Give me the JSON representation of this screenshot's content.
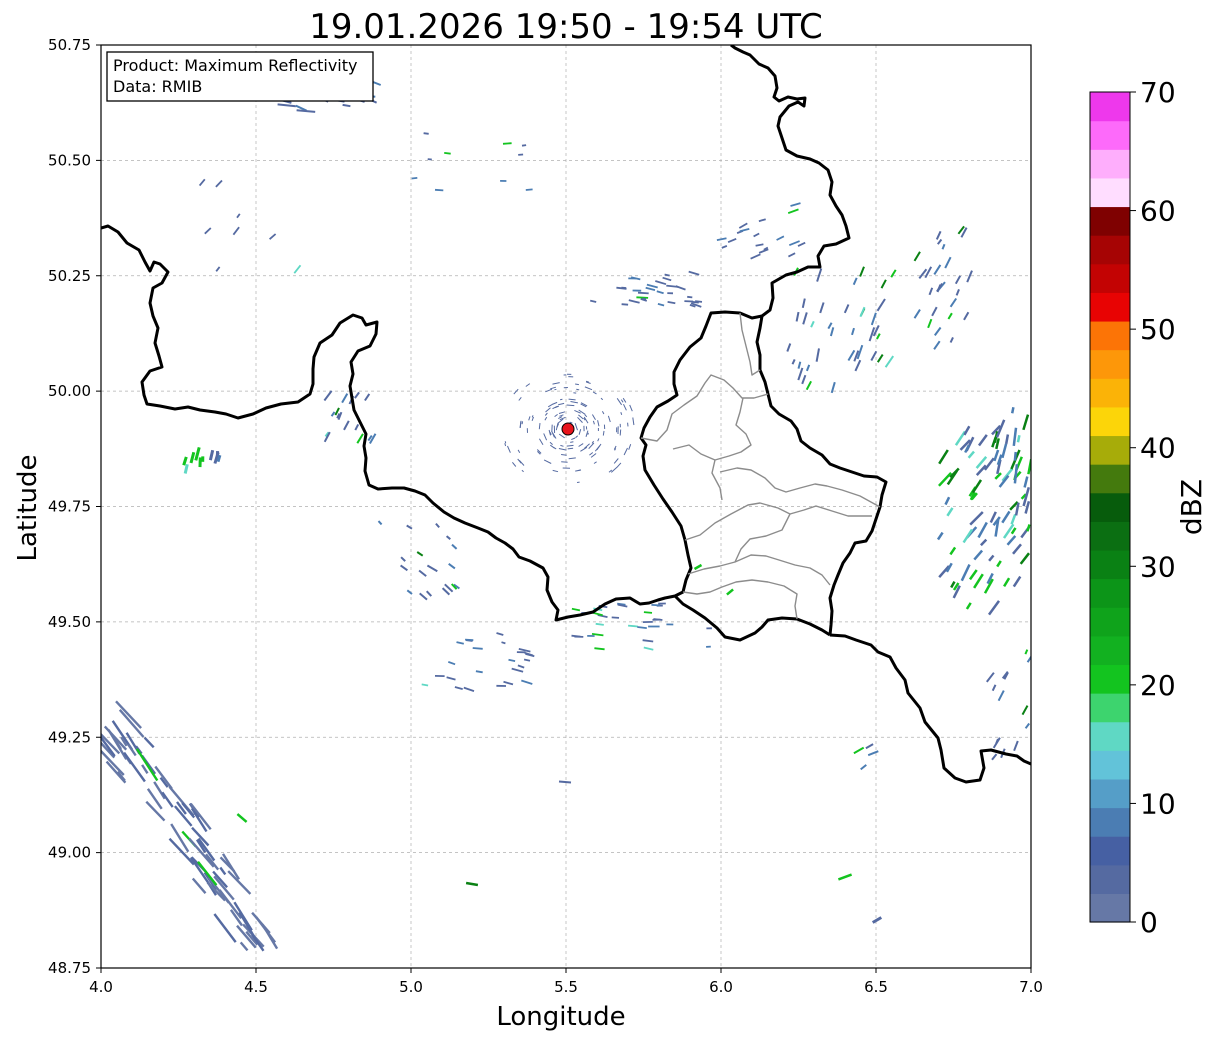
{
  "title": "19.01.2026 19:50 - 19:54 UTC",
  "info_box": {
    "line1": "Product: Maximum Reflectivity",
    "line2": "Data: RMIB"
  },
  "axes": {
    "xlabel": "Longitude",
    "ylabel": "Latitude",
    "xlim": [
      4.0,
      7.0
    ],
    "ylim": [
      48.75,
      50.75
    ],
    "xticks": [
      "4.0",
      "4.5",
      "5.0",
      "5.5",
      "6.0",
      "6.5",
      "7.0"
    ],
    "yticks": [
      "48.75",
      "49.00",
      "49.25",
      "49.50",
      "49.75",
      "50.00",
      "50.25",
      "50.50",
      "50.75"
    ],
    "grid": true
  },
  "radar_site": {
    "lon": 5.505,
    "lat": 49.915,
    "color": "#e8141c"
  },
  "colorbar": {
    "label": "dBZ",
    "min": 0,
    "max": 70,
    "ticks": [
      "0",
      "10",
      "20",
      "30",
      "40",
      "50",
      "60",
      "70"
    ],
    "colors": [
      "#6678a6",
      "#556aa1",
      "#4660a3",
      "#4b7db3",
      "#559ec8",
      "#62c3d9",
      "#5fd8c4",
      "#3dd46e",
      "#13c41f",
      "#12b120",
      "#0fa31b",
      "#0c9518",
      "#0a8114",
      "#0b6f12",
      "#075c0c",
      "#447a0d",
      "#a7ac09",
      "#fcd509",
      "#fbb307",
      "#fd9709",
      "#fc7406",
      "#e80303",
      "#c30303",
      "#a60404",
      "#7f0101",
      "#ffddff",
      "#feaefc",
      "#fd6afa",
      "#ee38ec"
    ]
  },
  "borders": {
    "national_color": "#000000",
    "regional_color": "#8c8c8c"
  },
  "echo_colors": {
    "weak": "#556aa1",
    "light": "#4b7db3",
    "cyan": "#5fd8c4",
    "green": "#13c41f",
    "dark_green": "#0a8114"
  }
}
